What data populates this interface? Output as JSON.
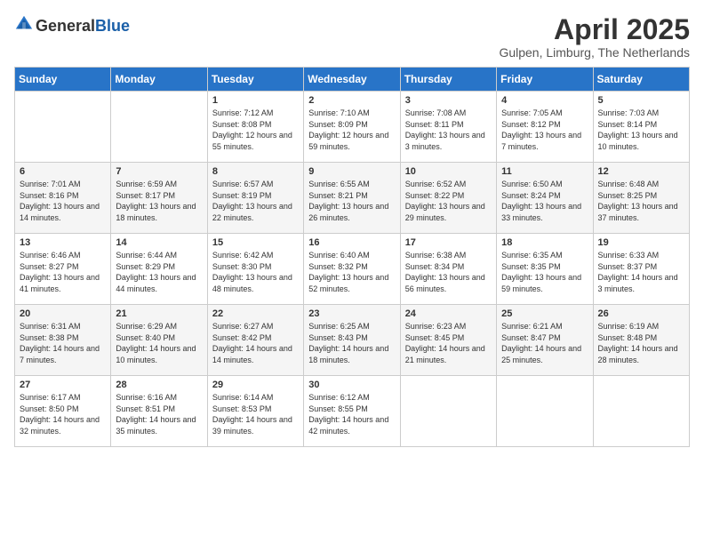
{
  "header": {
    "logo": {
      "general": "General",
      "blue": "Blue"
    },
    "title": "April 2025",
    "location": "Gulpen, Limburg, The Netherlands"
  },
  "weekdays": [
    "Sunday",
    "Monday",
    "Tuesday",
    "Wednesday",
    "Thursday",
    "Friday",
    "Saturday"
  ],
  "weeks": [
    [
      {
        "day": "",
        "info": ""
      },
      {
        "day": "",
        "info": ""
      },
      {
        "day": "1",
        "info": "Sunrise: 7:12 AM\nSunset: 8:08 PM\nDaylight: 12 hours and 55 minutes."
      },
      {
        "day": "2",
        "info": "Sunrise: 7:10 AM\nSunset: 8:09 PM\nDaylight: 12 hours and 59 minutes."
      },
      {
        "day": "3",
        "info": "Sunrise: 7:08 AM\nSunset: 8:11 PM\nDaylight: 13 hours and 3 minutes."
      },
      {
        "day": "4",
        "info": "Sunrise: 7:05 AM\nSunset: 8:12 PM\nDaylight: 13 hours and 7 minutes."
      },
      {
        "day": "5",
        "info": "Sunrise: 7:03 AM\nSunset: 8:14 PM\nDaylight: 13 hours and 10 minutes."
      }
    ],
    [
      {
        "day": "6",
        "info": "Sunrise: 7:01 AM\nSunset: 8:16 PM\nDaylight: 13 hours and 14 minutes."
      },
      {
        "day": "7",
        "info": "Sunrise: 6:59 AM\nSunset: 8:17 PM\nDaylight: 13 hours and 18 minutes."
      },
      {
        "day": "8",
        "info": "Sunrise: 6:57 AM\nSunset: 8:19 PM\nDaylight: 13 hours and 22 minutes."
      },
      {
        "day": "9",
        "info": "Sunrise: 6:55 AM\nSunset: 8:21 PM\nDaylight: 13 hours and 26 minutes."
      },
      {
        "day": "10",
        "info": "Sunrise: 6:52 AM\nSunset: 8:22 PM\nDaylight: 13 hours and 29 minutes."
      },
      {
        "day": "11",
        "info": "Sunrise: 6:50 AM\nSunset: 8:24 PM\nDaylight: 13 hours and 33 minutes."
      },
      {
        "day": "12",
        "info": "Sunrise: 6:48 AM\nSunset: 8:25 PM\nDaylight: 13 hours and 37 minutes."
      }
    ],
    [
      {
        "day": "13",
        "info": "Sunrise: 6:46 AM\nSunset: 8:27 PM\nDaylight: 13 hours and 41 minutes."
      },
      {
        "day": "14",
        "info": "Sunrise: 6:44 AM\nSunset: 8:29 PM\nDaylight: 13 hours and 44 minutes."
      },
      {
        "day": "15",
        "info": "Sunrise: 6:42 AM\nSunset: 8:30 PM\nDaylight: 13 hours and 48 minutes."
      },
      {
        "day": "16",
        "info": "Sunrise: 6:40 AM\nSunset: 8:32 PM\nDaylight: 13 hours and 52 minutes."
      },
      {
        "day": "17",
        "info": "Sunrise: 6:38 AM\nSunset: 8:34 PM\nDaylight: 13 hours and 56 minutes."
      },
      {
        "day": "18",
        "info": "Sunrise: 6:35 AM\nSunset: 8:35 PM\nDaylight: 13 hours and 59 minutes."
      },
      {
        "day": "19",
        "info": "Sunrise: 6:33 AM\nSunset: 8:37 PM\nDaylight: 14 hours and 3 minutes."
      }
    ],
    [
      {
        "day": "20",
        "info": "Sunrise: 6:31 AM\nSunset: 8:38 PM\nDaylight: 14 hours and 7 minutes."
      },
      {
        "day": "21",
        "info": "Sunrise: 6:29 AM\nSunset: 8:40 PM\nDaylight: 14 hours and 10 minutes."
      },
      {
        "day": "22",
        "info": "Sunrise: 6:27 AM\nSunset: 8:42 PM\nDaylight: 14 hours and 14 minutes."
      },
      {
        "day": "23",
        "info": "Sunrise: 6:25 AM\nSunset: 8:43 PM\nDaylight: 14 hours and 18 minutes."
      },
      {
        "day": "24",
        "info": "Sunrise: 6:23 AM\nSunset: 8:45 PM\nDaylight: 14 hours and 21 minutes."
      },
      {
        "day": "25",
        "info": "Sunrise: 6:21 AM\nSunset: 8:47 PM\nDaylight: 14 hours and 25 minutes."
      },
      {
        "day": "26",
        "info": "Sunrise: 6:19 AM\nSunset: 8:48 PM\nDaylight: 14 hours and 28 minutes."
      }
    ],
    [
      {
        "day": "27",
        "info": "Sunrise: 6:17 AM\nSunset: 8:50 PM\nDaylight: 14 hours and 32 minutes."
      },
      {
        "day": "28",
        "info": "Sunrise: 6:16 AM\nSunset: 8:51 PM\nDaylight: 14 hours and 35 minutes."
      },
      {
        "day": "29",
        "info": "Sunrise: 6:14 AM\nSunset: 8:53 PM\nDaylight: 14 hours and 39 minutes."
      },
      {
        "day": "30",
        "info": "Sunrise: 6:12 AM\nSunset: 8:55 PM\nDaylight: 14 hours and 42 minutes."
      },
      {
        "day": "",
        "info": ""
      },
      {
        "day": "",
        "info": ""
      },
      {
        "day": "",
        "info": ""
      }
    ]
  ]
}
